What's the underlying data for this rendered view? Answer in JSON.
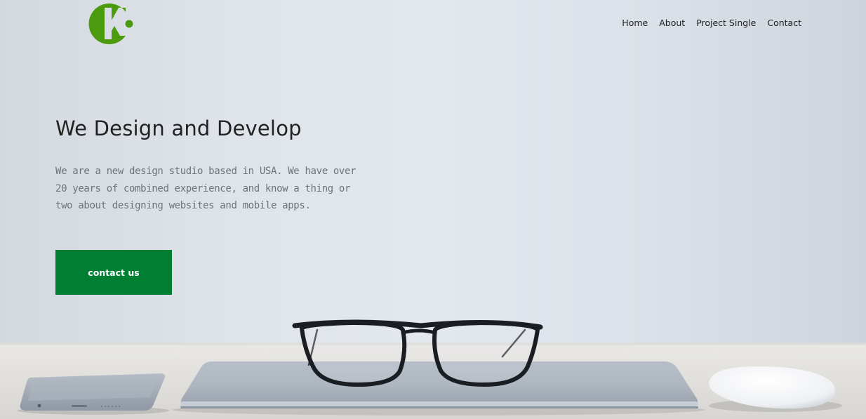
{
  "brand": {
    "logo_icon": "ck-logo-icon",
    "color": "#4c9a0e"
  },
  "nav": {
    "items": [
      {
        "label": "Home"
      },
      {
        "label": "About"
      },
      {
        "label": "Project Single"
      },
      {
        "label": "Contact"
      }
    ]
  },
  "hero": {
    "title": "We Design and Develop",
    "description": "We are a new design studio based in USA. We have over 20 years of combined experience, and know a thing or two about designing websites and mobile apps.",
    "cta_label": "contact us",
    "cta_color": "#007f33",
    "background_scene": [
      "phone-image",
      "laptop-image",
      "glasses-image",
      "mouse-image"
    ]
  }
}
